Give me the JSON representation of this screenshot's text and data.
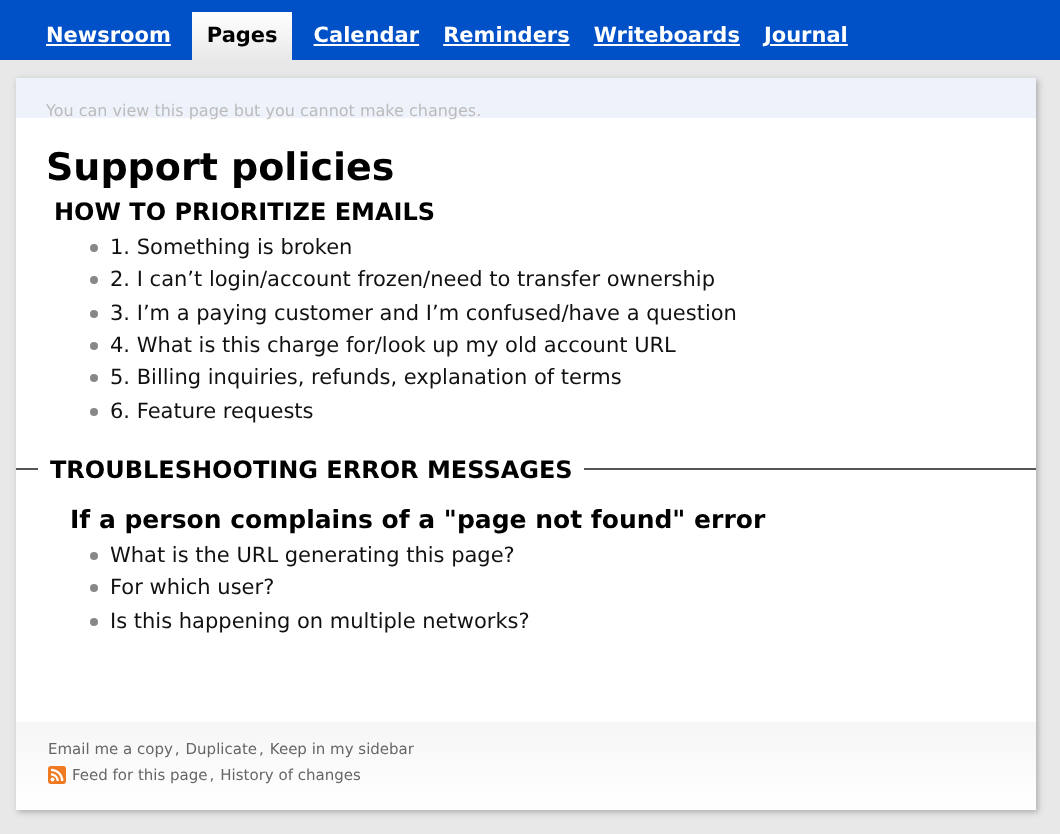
{
  "tabs": [
    {
      "label": "Newsroom",
      "selected": false
    },
    {
      "label": "Pages",
      "selected": true
    },
    {
      "label": "Calendar",
      "selected": false
    },
    {
      "label": "Reminders",
      "selected": false
    },
    {
      "label": "Writeboards",
      "selected": false
    },
    {
      "label": "Journal",
      "selected": false
    }
  ],
  "notice": "You can view this page but you cannot make changes.",
  "title": "Support policies",
  "sections": [
    {
      "heading": "HOW TO PRIORITIZE EMAILS",
      "divider": false,
      "items": [
        "1. Something is broken",
        "2. I can’t login/account frozen/need to transfer ownership",
        "3. I’m a paying customer and I’m confused/have a question",
        "4. What is this charge for/look up my old account URL",
        "5. Billing inquiries, refunds, explanation of terms",
        "6. Feature requests"
      ]
    },
    {
      "heading": "TROUBLESHOOTING ERROR MESSAGES",
      "divider": true,
      "subheading": "If a person complains of a \"page not found\" error",
      "items": [
        "What is the URL generating this page?",
        "For which user?",
        "Is this happening on multiple networks?"
      ]
    }
  ],
  "footer": {
    "separator": ",",
    "rows": [
      {
        "feed": false,
        "links": [
          "Email me a copy",
          "Duplicate",
          "Keep in my sidebar"
        ]
      },
      {
        "feed": true,
        "links": [
          "Feed for this page",
          "History of changes"
        ]
      }
    ]
  }
}
